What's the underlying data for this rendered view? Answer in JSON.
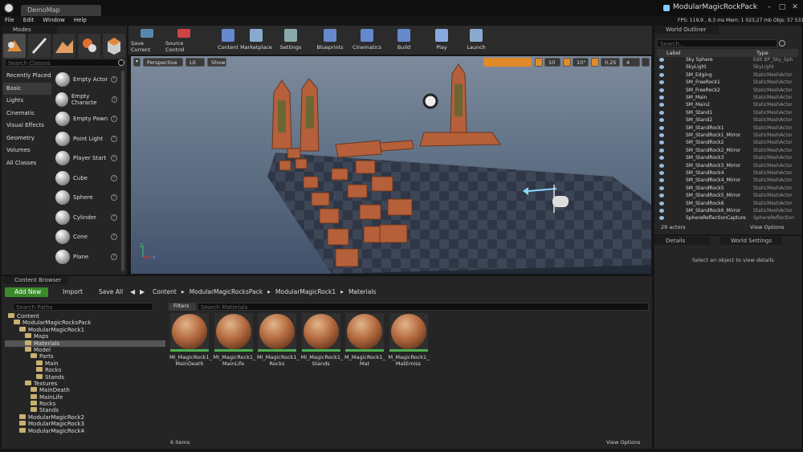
{
  "window": {
    "doc_tab": "DemoMap",
    "project_name": "ModularMagicRockPack"
  },
  "menu": [
    "File",
    "Edit",
    "Window",
    "Help"
  ],
  "stats": {
    "text": "FPS: 119,9 ,  8,3 ms   Mem: 1 023,27 mb   Objs: 57 531"
  },
  "modes": {
    "tab_label": "Modes",
    "search_placeholder": "Search Classes",
    "categories": [
      "Recently Placed",
      "Basic",
      "Lights",
      "Cinematic",
      "Visual Effects",
      "Geometry",
      "Volumes",
      "All Classes"
    ],
    "selected_category": "Basic",
    "items": [
      "Empty Actor",
      "Empty Characte",
      "Empty Pawn",
      "Point Light",
      "Player Start",
      "Cube",
      "Sphere",
      "Cylinder",
      "Cone",
      "Plane"
    ]
  },
  "toolbar": {
    "buttons": [
      "Save Current",
      "Source Control",
      "Content",
      "Marketplace",
      "Settings",
      "Blueprints",
      "Cinematics",
      "Build",
      "Play",
      "Launch"
    ]
  },
  "viewport": {
    "perspective": "Perspective",
    "lit": "Lit",
    "show": "Show",
    "grid_snap": "10",
    "rot_snap": "10°",
    "scale_snap": "0,25",
    "cam_speed": "4",
    "axis_x": "X",
    "axis_y": "Y",
    "axis_z": "Z"
  },
  "outliner": {
    "tab_label": "World Outliner",
    "search_placeholder": "Search...",
    "col_label": "Label",
    "col_type": "Type",
    "rows": [
      {
        "name": "Sky Sphere",
        "type": "Edit BP_Sky_Sph"
      },
      {
        "name": "SkyLight",
        "type": "SkyLight"
      },
      {
        "name": "SM_Edging",
        "type": "StaticMeshActor"
      },
      {
        "name": "SM_FreeRock1",
        "type": "StaticMeshActor"
      },
      {
        "name": "SM_FreeRock2",
        "type": "StaticMeshActor"
      },
      {
        "name": "SM_Main",
        "type": "StaticMeshActor"
      },
      {
        "name": "SM_Main2",
        "type": "StaticMeshActor"
      },
      {
        "name": "SM_Stand1",
        "type": "StaticMeshActor"
      },
      {
        "name": "SM_Stand2",
        "type": "StaticMeshActor"
      },
      {
        "name": "SM_StandRock1",
        "type": "StaticMeshActor"
      },
      {
        "name": "SM_StandRock1_Mirror",
        "type": "StaticMeshActor"
      },
      {
        "name": "SM_StandRock2",
        "type": "StaticMeshActor"
      },
      {
        "name": "SM_StandRock2_Mirror",
        "type": "StaticMeshActor"
      },
      {
        "name": "SM_StandRock3",
        "type": "StaticMeshActor"
      },
      {
        "name": "SM_StandRock3_Mirror",
        "type": "StaticMeshActor"
      },
      {
        "name": "SM_StandRock4",
        "type": "StaticMeshActor"
      },
      {
        "name": "SM_StandRock4_Mirror",
        "type": "StaticMeshActor"
      },
      {
        "name": "SM_StandRock5",
        "type": "StaticMeshActor"
      },
      {
        "name": "SM_StandRock5_Mirror",
        "type": "StaticMeshActor"
      },
      {
        "name": "SM_StandRock6",
        "type": "StaticMeshActor"
      },
      {
        "name": "SM_StandRock6_Mirror",
        "type": "StaticMeshActor"
      },
      {
        "name": "SphereReflectionCapture",
        "type": "SphereReflection"
      }
    ],
    "count": "29 actors",
    "view_options": "View Options"
  },
  "details": {
    "tab_details": "Details",
    "tab_world": "World Settings",
    "empty_msg": "Select an object to view details"
  },
  "content_browser": {
    "tab_label": "Content Browser",
    "add_new": "Add New",
    "import": "Import",
    "save_all": "Save All",
    "breadcrumbs": [
      "Content",
      "ModularMagicRocksPack",
      "ModularMagicRock1",
      "Materials"
    ],
    "search_paths": "Search Paths",
    "filters": "Filters",
    "search_materials": "Search Materials",
    "tree": [
      {
        "label": "Content",
        "depth": 0
      },
      {
        "label": "ModularMagicRocksPack",
        "depth": 1
      },
      {
        "label": "ModularMagicRock1",
        "depth": 2
      },
      {
        "label": "Maps",
        "depth": 3
      },
      {
        "label": "Materials",
        "depth": 3
      },
      {
        "label": "Model",
        "depth": 3
      },
      {
        "label": "Parts",
        "depth": 4
      },
      {
        "label": "Main",
        "depth": 5
      },
      {
        "label": "Rocks",
        "depth": 5
      },
      {
        "label": "Stands",
        "depth": 5
      },
      {
        "label": "Textures",
        "depth": 3
      },
      {
        "label": "MainDeath",
        "depth": 4
      },
      {
        "label": "MainLife",
        "depth": 4
      },
      {
        "label": "Rocks",
        "depth": 4
      },
      {
        "label": "Stands",
        "depth": 4
      },
      {
        "label": "ModularMagicRock2",
        "depth": 2
      },
      {
        "label": "ModularMagicRock3",
        "depth": 2
      },
      {
        "label": "ModularMagicRock4",
        "depth": 2
      }
    ],
    "assets": [
      {
        "l1": "MI_MagicRock1_",
        "l2": "MainDeath"
      },
      {
        "l1": "MI_MagicRock1_",
        "l2": "MainLife"
      },
      {
        "l1": "MI_MagicRock1_",
        "l2": "Rocks"
      },
      {
        "l1": "MI_MagicRock1_",
        "l2": "Stands"
      },
      {
        "l1": "M_MagicRock1_",
        "l2": "Mat"
      },
      {
        "l1": "M_MagicRock1_",
        "l2": "MatEmiss"
      }
    ],
    "item_count": "6 items",
    "view_options": "View Options"
  }
}
